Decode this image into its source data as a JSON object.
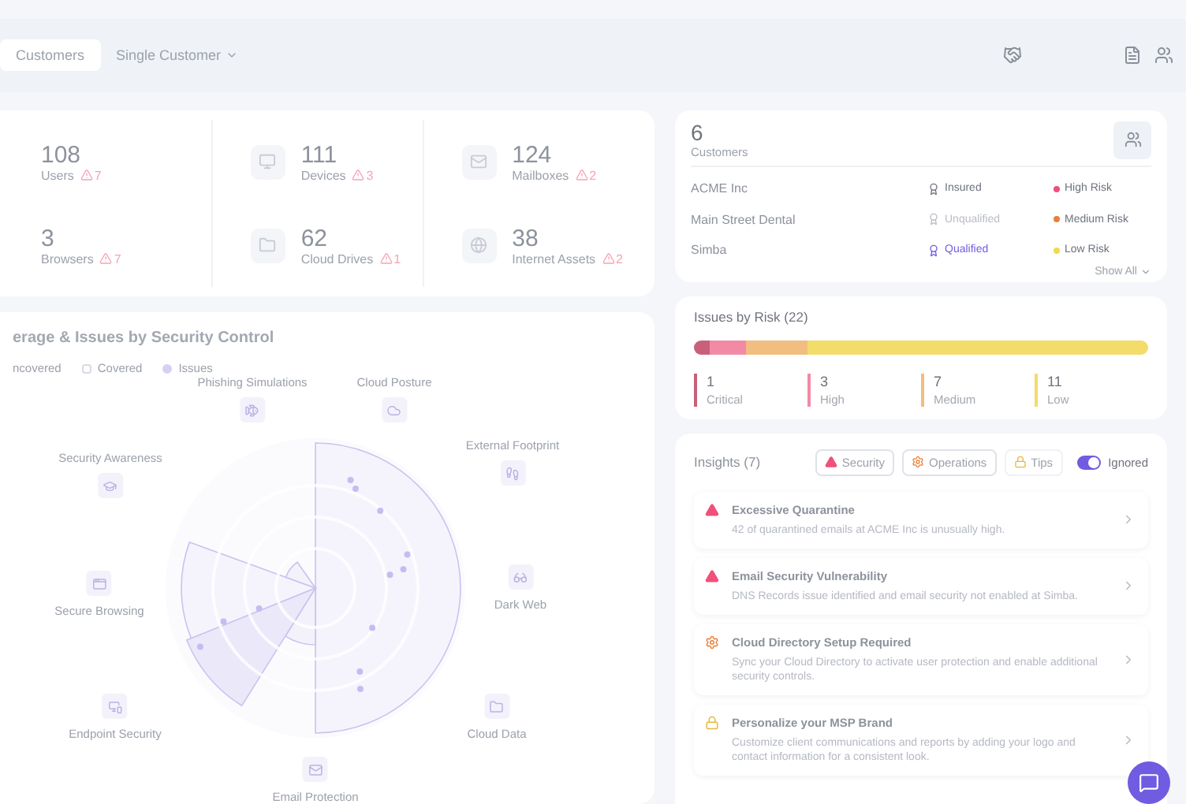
{
  "top_bar": {
    "tabs": [
      {
        "label": "Customers",
        "selected": true,
        "kind": "tab"
      },
      {
        "label": "Single Customer",
        "selected": false,
        "kind": "dropdown"
      }
    ]
  },
  "stats": [
    {
      "value": "108",
      "label": "Users",
      "issues": "7"
    },
    {
      "value": "111",
      "label": "Devices",
      "issues": "3"
    },
    {
      "value": "124",
      "label": "Mailboxes",
      "issues": "2"
    },
    {
      "value": "3",
      "label": "Browsers",
      "issues": "7"
    },
    {
      "value": "62",
      "label": "Cloud Drives",
      "issues": "1"
    },
    {
      "value": "38",
      "label": "Internet Assets",
      "issues": "2"
    }
  ],
  "coverage": {
    "title": "erage & Issues by Security Control",
    "legend": [
      {
        "label": "ncovered",
        "kind": "uncovered"
      },
      {
        "label": "Covered",
        "kind": "covered"
      },
      {
        "label": "Issues",
        "kind": "issues"
      }
    ],
    "controls": [
      "Phishing Simulations",
      "Cloud Posture",
      "Security Awareness",
      "External Footprint",
      "Secure Browsing",
      "Dark Web",
      "Endpoint Security",
      "Cloud Data",
      "Email Protection"
    ]
  },
  "customers": {
    "count": "6",
    "label": "Customers",
    "show_all": "Show All",
    "rows": [
      {
        "name": "ACME Inc",
        "status": "Insured",
        "kind": "insured",
        "risk": "High Risk",
        "color": "#f0507a"
      },
      {
        "name": "Main Street Dental",
        "status": "Unqualified",
        "kind": "unqualified",
        "risk": "Medium Risk",
        "color": "#e8803a"
      },
      {
        "name": "Simba",
        "status": "Qualified",
        "kind": "qualified",
        "risk": "Low Risk",
        "color": "#f2d94e"
      }
    ]
  },
  "issues_by_risk": {
    "title": "Issues by Risk (22)",
    "bar": [
      {
        "color": "#c9607a",
        "level": 0.035
      },
      {
        "color": "#f28aa6",
        "level": 0.08
      },
      {
        "color": "#f2bd80",
        "level": 0.135
      },
      {
        "color": "#f3dc6a",
        "level": 0.75
      }
    ],
    "levels": [
      {
        "count": "1",
        "label": "Critical",
        "color": "#c9607a"
      },
      {
        "count": "3",
        "label": "High",
        "color": "#f28aa6"
      },
      {
        "count": "7",
        "label": "Medium",
        "color": "#f2bd80"
      },
      {
        "count": "11",
        "label": "Low",
        "color": "#f3dc6a"
      }
    ]
  },
  "insights": {
    "title": "Insights (7)",
    "filters": [
      {
        "label": "Security",
        "kind": "security",
        "selected": true
      },
      {
        "label": "Operations",
        "kind": "operations",
        "selected": true
      },
      {
        "label": "Tips",
        "kind": "tips",
        "selected": false
      }
    ],
    "ignored": {
      "label": "Ignored",
      "on": true
    },
    "items": [
      {
        "kind": "security",
        "title": "Excessive Quarantine",
        "text": "42 of quarantined emails at ACME Inc is unusually high."
      },
      {
        "kind": "security",
        "title": "Email Security Vulnerability",
        "text": "DNS Records issue identified and email security not enabled at Simba."
      },
      {
        "kind": "operations",
        "title": "Cloud Directory Setup Required",
        "text": "Sync your Cloud Directory to activate user protection and enable additional security controls."
      },
      {
        "kind": "tips",
        "title": "Personalize your MSP Brand",
        "text": "Customize client communications and reports by adding your logo and contact information for a consistent look."
      }
    ]
  }
}
